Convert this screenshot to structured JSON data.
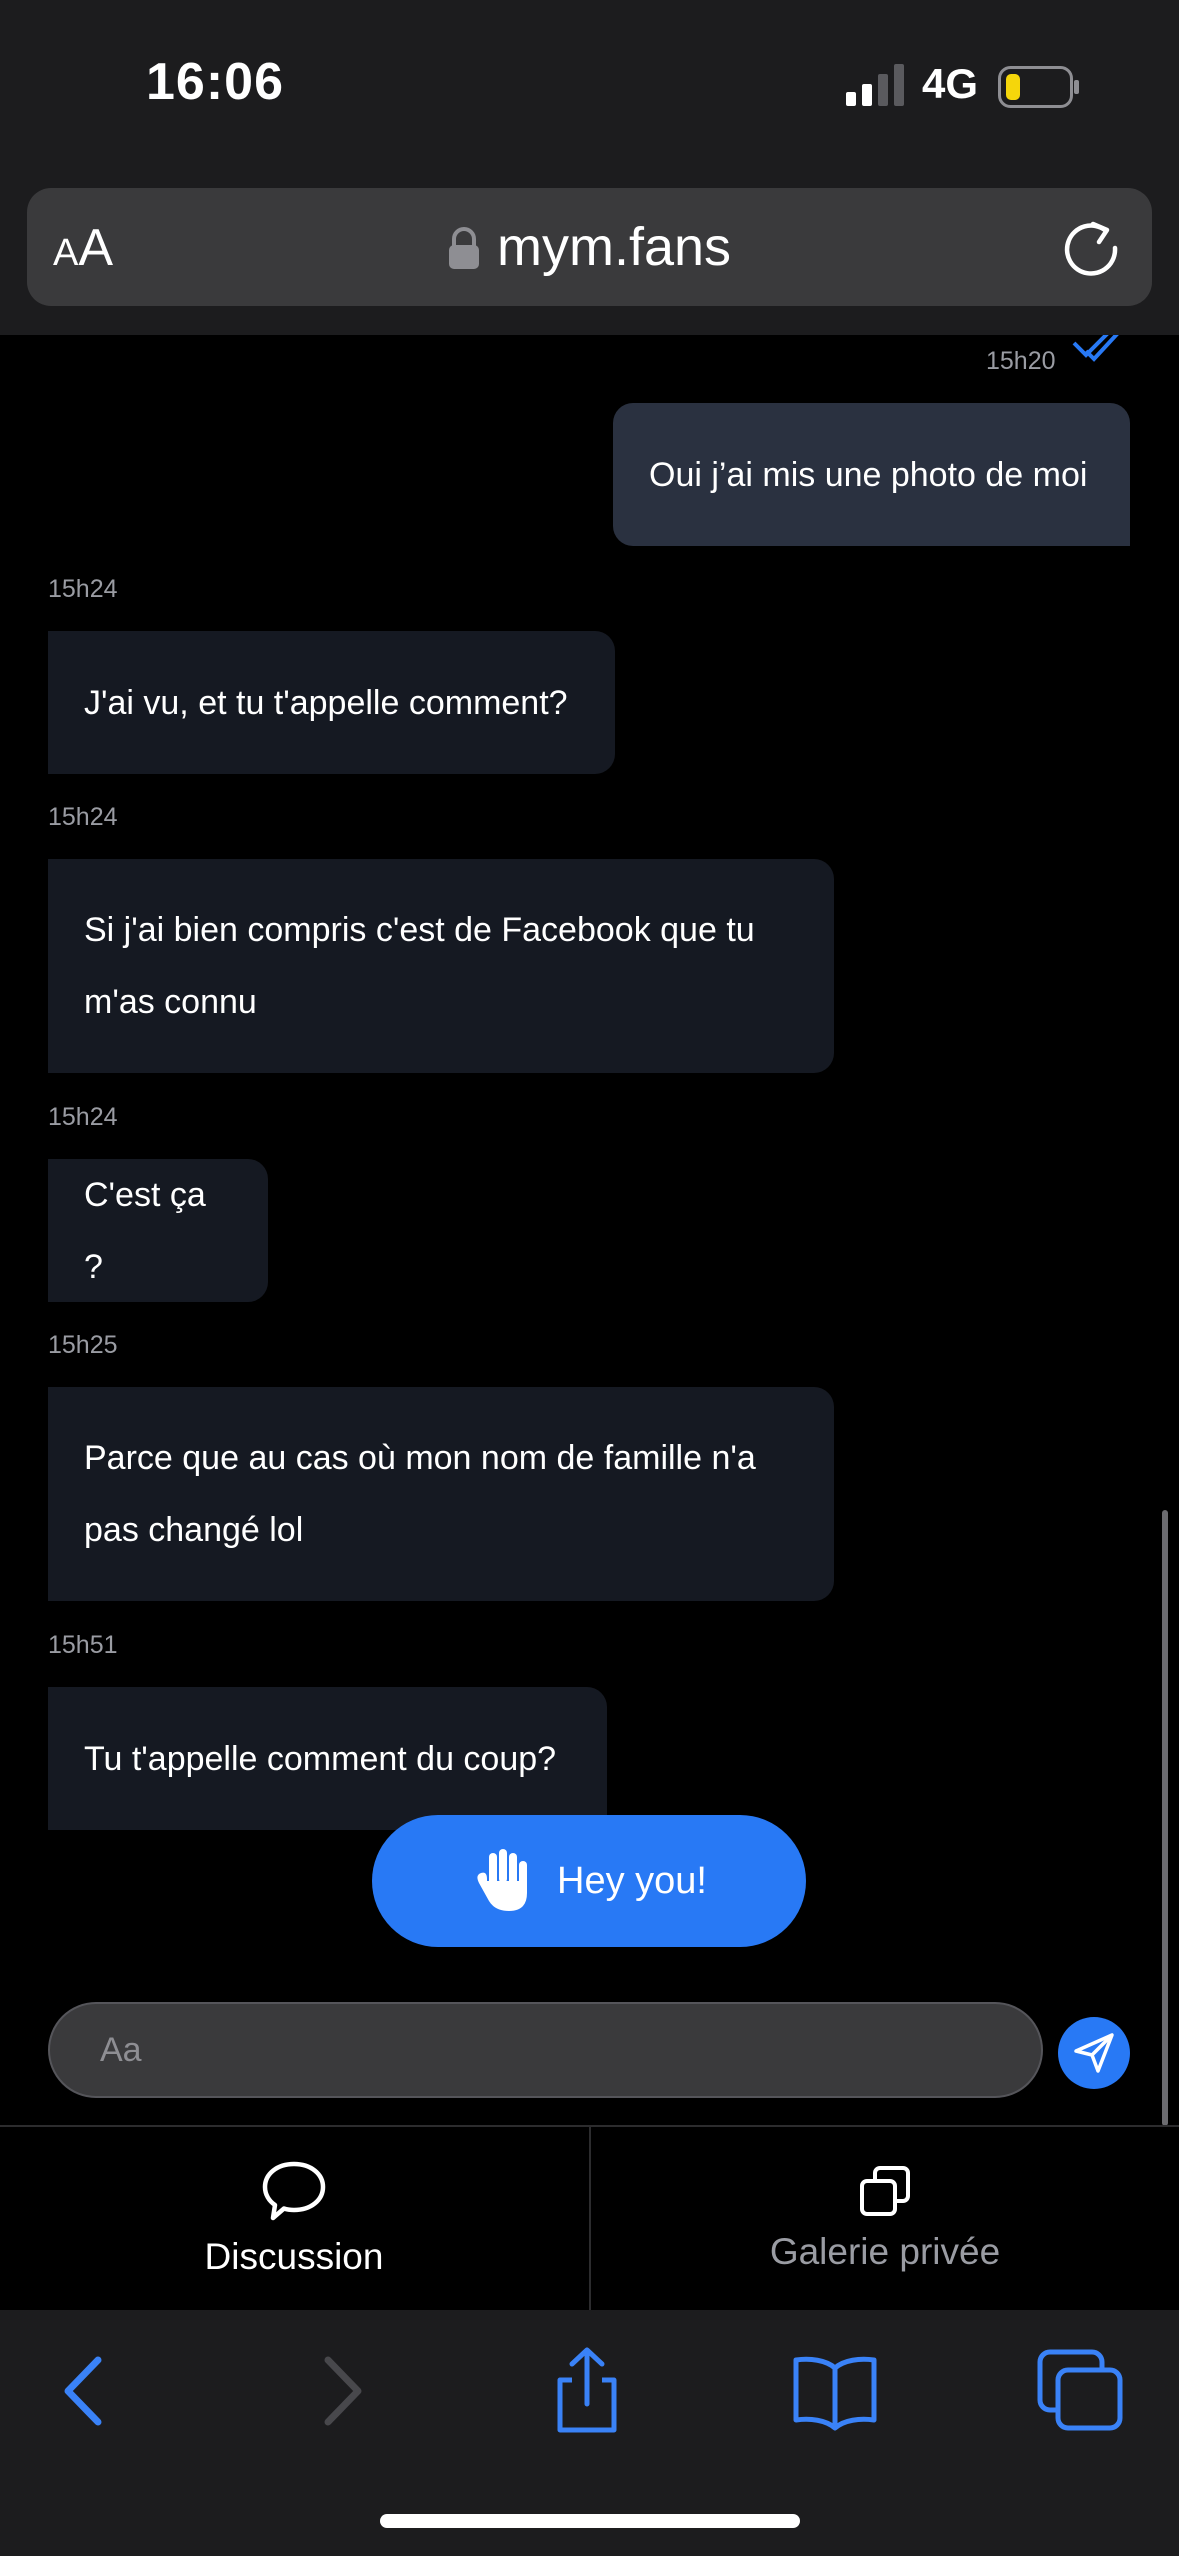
{
  "status": {
    "time": "16:06",
    "network": "4G"
  },
  "browser": {
    "text_size_label": "AA",
    "url": "mym.fans"
  },
  "chat": {
    "messages": [
      {
        "direction": "out",
        "time": "15h20",
        "text": "Oui j’ai mis une photo de moi"
      },
      {
        "direction": "in",
        "time": "15h24",
        "text": "J'ai vu, et tu t'appelle comment?"
      },
      {
        "direction": "in",
        "time": "15h24",
        "text": "Si j'ai bien compris c'est de Facebook que tu m'as connu"
      },
      {
        "direction": "in",
        "time": "15h24",
        "text": "C'est ça ?"
      },
      {
        "direction": "in",
        "time": "15h25",
        "text": "Parce que au cas où mon nom de famille n'a pas changé lol"
      },
      {
        "direction": "in",
        "time": "15h51",
        "text": "Tu t'appelle comment du coup?"
      }
    ],
    "hey_button_label": "Hey you!",
    "input_placeholder": "Aa"
  },
  "tabs": [
    {
      "label": "Discussion",
      "icon": "speech-bubble-icon",
      "active": true
    },
    {
      "label": "Galerie privée",
      "icon": "gallery-copy-icon",
      "active": false
    }
  ],
  "colors": {
    "accent": "#2879f5",
    "incoming_bubble": "#151922",
    "outgoing_bubble": "#2a3140",
    "background": "#000000"
  },
  "toolbar": {
    "icons": [
      "back-icon",
      "forward-icon",
      "share-icon",
      "bookmarks-icon",
      "tabs-icon"
    ]
  }
}
